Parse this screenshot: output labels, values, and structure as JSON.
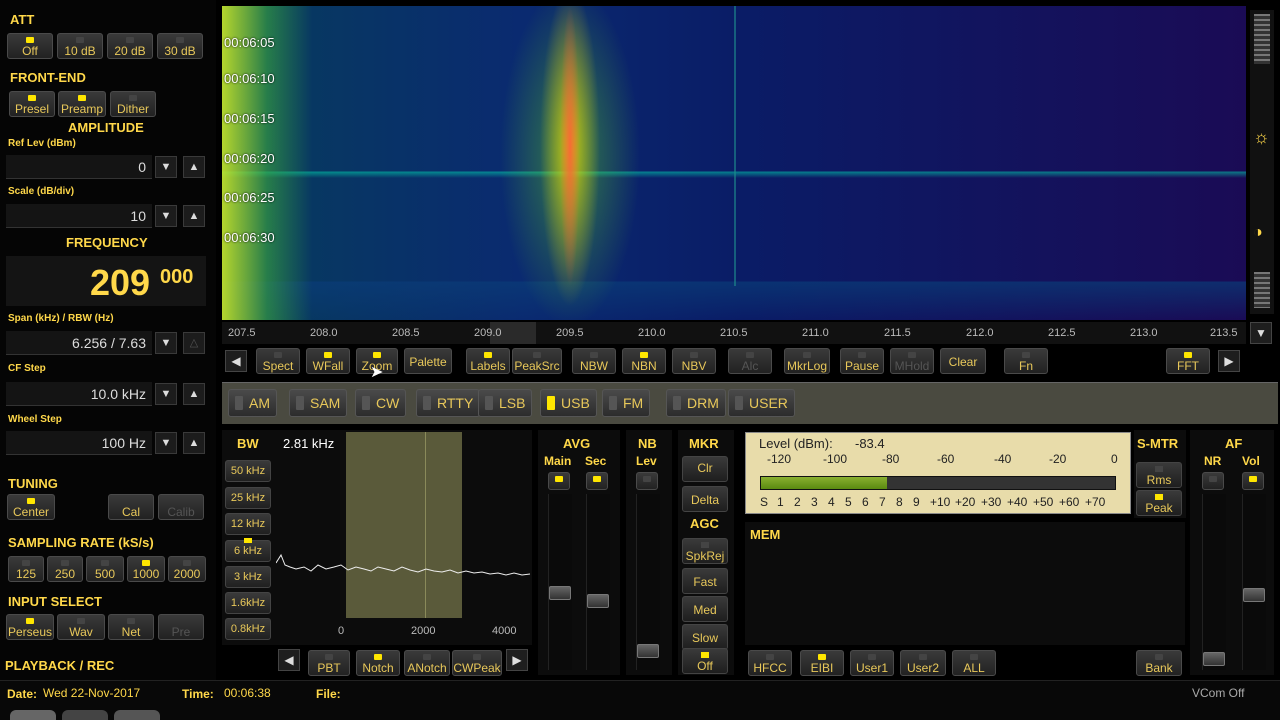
{
  "left": {
    "att": {
      "title": "ATT",
      "buttons": [
        "Off",
        "10 dB",
        "20 dB",
        "30 dB"
      ]
    },
    "frontend": {
      "title": "FRONT-END",
      "buttons": [
        "Presel",
        "Preamp",
        "Dither"
      ]
    },
    "amplitude": {
      "title": "AMPLITUDE",
      "ref_label": "Ref Lev (dBm)",
      "ref_value": "0",
      "scale_label": "Scale (dB/div)",
      "scale_value": "10"
    },
    "frequency": {
      "title": "FREQUENCY",
      "main": "209",
      "sub": "000",
      "span_label": "Span (kHz) / RBW (Hz)",
      "span_value": "6.256 / 7.63",
      "cf_label": "CF Step",
      "cf_value": "10.0 kHz",
      "wheel_label": "Wheel Step",
      "wheel_value": "100 Hz"
    },
    "tuning": {
      "title": "TUNING",
      "center": "Center",
      "cal": "Cal",
      "calib": "Calib"
    },
    "sampling": {
      "title": "SAMPLING RATE (kS/s)",
      "rates": [
        "125",
        "250",
        "500",
        "1000",
        "2000"
      ]
    },
    "input": {
      "title": "INPUT SELECT",
      "buttons": [
        "Perseus",
        "Wav",
        "Net",
        "Pre"
      ]
    },
    "playback": {
      "title": "PLAYBACK / REC"
    }
  },
  "waterfall": {
    "times": [
      "00:06:05",
      "00:06:10",
      "00:06:15",
      "00:06:20",
      "00:06:25",
      "00:06:30"
    ],
    "freq_ticks": [
      "207.5",
      "208.0",
      "208.5",
      "209.0",
      "209.5",
      "210.0",
      "210.5",
      "211.0",
      "211.5",
      "212.0",
      "212.5",
      "213.0",
      "213.5"
    ]
  },
  "toolbar": [
    "Spect",
    "WFall",
    "Zoom",
    "Palette",
    "Labels",
    "PeakSrc",
    "NBW",
    "NBN",
    "NBV",
    "Alc",
    "MkrLog",
    "Pause",
    "MHold",
    "Clear",
    "Fn",
    "FFT"
  ],
  "modes": [
    "AM",
    "SAM",
    "CW",
    "RTTY",
    "LSB",
    "USB",
    "FM",
    "DRM",
    "USER"
  ],
  "bw": {
    "title": "BW",
    "value": "2.81 kHz",
    "buttons": [
      "50 kHz",
      "25 kHz",
      "12 kHz",
      "6 kHz",
      "3 kHz",
      "1.6kHz",
      "0.8kHz"
    ],
    "axis": [
      "0",
      "2000",
      "4000"
    ]
  },
  "audio_buttons": [
    "PBT",
    "Notch",
    "ANotch",
    "CWPeak"
  ],
  "avg": {
    "title": "AVG",
    "main": "Main",
    "sec": "Sec"
  },
  "nb": {
    "title": "NB",
    "lev": "Lev"
  },
  "mkr": {
    "title": "MKR",
    "clr": "Clr",
    "delta": "Delta"
  },
  "agc": {
    "title": "AGC",
    "buttons": [
      "SpkRej",
      "Fast",
      "Med",
      "Slow",
      "Off"
    ]
  },
  "meter": {
    "level_label": "Level (dBm):",
    "level_value": "-83.4",
    "level_fraction": 0.355,
    "dbm_scale": [
      "-120",
      "-100",
      "-80",
      "-60",
      "-40",
      "-20",
      "0"
    ],
    "s_scale": [
      "S",
      "1",
      "2",
      "3",
      "4",
      "5",
      "6",
      "7",
      "8",
      "9",
      "+10",
      "+20",
      "+30",
      "+40",
      "+50",
      "+60",
      "+70"
    ]
  },
  "smtr": {
    "title": "S-MTR",
    "rms": "Rms",
    "peak": "Peak"
  },
  "af": {
    "title": "AF",
    "nr": "NR",
    "vol": "Vol"
  },
  "mem": {
    "title": "MEM",
    "buttons": [
      "HFCC",
      "EIBI",
      "User1",
      "User2",
      "ALL"
    ],
    "bank": "Bank"
  },
  "status": {
    "date_label": "Date:",
    "date_value": "Wed 22-Nov-2017",
    "time_label": "Time:",
    "time_value": "00:06:38",
    "file_label": "File:",
    "vcom": "VCom Off"
  }
}
